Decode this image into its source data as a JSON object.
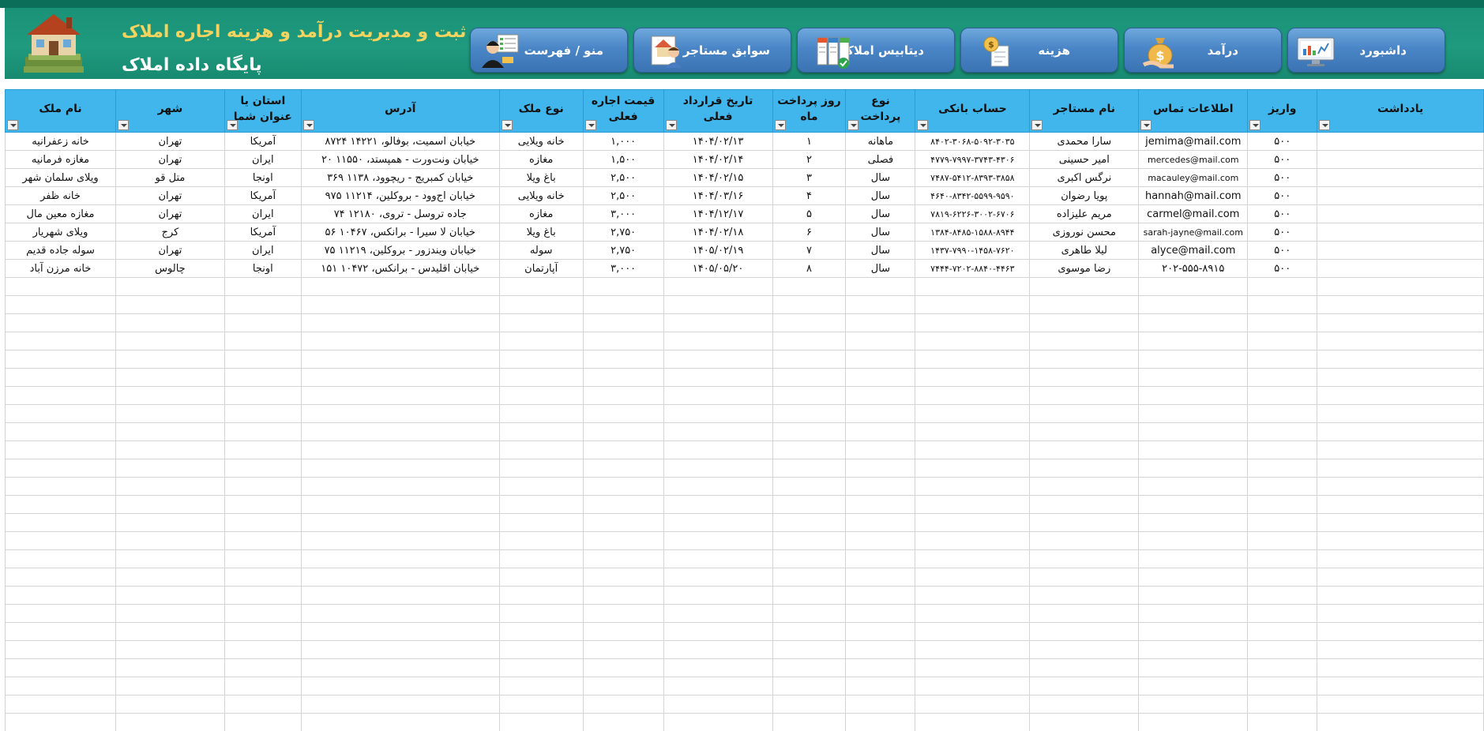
{
  "header": {
    "title": "ثبت و مدیریت درآمد و هزینه اجاره املاک",
    "subtitle": "پایگاه داده املاک"
  },
  "nav": [
    {
      "label": "داشبورد",
      "icon": "dashboard-monitor-icon"
    },
    {
      "label": "درآمد",
      "icon": "money-bag-icon"
    },
    {
      "label": "هزینه",
      "icon": "expense-receipt-icon"
    },
    {
      "label": "دیتابیس املاک",
      "icon": "property-database-icon"
    },
    {
      "label": "سوابق مستاجر",
      "icon": "tenant-history-icon"
    },
    {
      "label": "منو / فهرست",
      "icon": "menu-person-icon"
    }
  ],
  "table": {
    "columns": [
      "یادداشت",
      "واریز",
      "اطلاعات تماس",
      "نام مستاجر",
      "حساب بانکی",
      "نوع پرداخت",
      "روز پرداخت ماه",
      "تاریخ قرارداد فعلی",
      "قیمت اجاره فعلی",
      "نوع ملک",
      "آدرس",
      "استان یا عنوان شما",
      "شهر",
      "نام ملک"
    ],
    "rows": [
      [
        "",
        "۵۰۰",
        "jemima@mail.com",
        "سارا محمدی",
        "۸۴۰۲-۳۰۶۸-۵۰۹۲-۳۰۳۵",
        "ماهانه",
        "۱",
        "۱۴۰۴/۰۲/۱۳",
        "۱,۰۰۰",
        "خانه ویلایی",
        "خیابان اسمیت، بوفالو، ۱۴۲۲۱ ۸۷۲۴",
        "آمریکا",
        "تهران",
        "خانه زعفرانیه"
      ],
      [
        "",
        "۵۰۰",
        "mercedes@mail.com",
        "امیر حسینی",
        "۴۷۷۹-۷۹۹۷-۳۷۴۳-۴۳۰۶",
        "فصلی",
        "۲",
        "۱۴۰۴/۰۲/۱۴",
        "۱,۵۰۰",
        "مغازه",
        "خیابان ونت‌ورت - همپستد، ۱۱۵۵۰ ۲۰",
        "ایران",
        "تهران",
        "مغازه فرمانیه"
      ],
      [
        "",
        "۵۰۰",
        "macauley@mail.com",
        "نرگس اکبری",
        "۷۴۸۷-۵۴۱۲-۸۳۹۳-۳۸۵۸",
        "سال",
        "۳",
        "۱۴۰۴/۰۲/۱۵",
        "۲,۵۰۰",
        "باغ ویلا",
        "خیابان کمبریج - ریچوود، ۱۱۳۸ ۳۶۹",
        "اونجا",
        "متل قو",
        "ویلای سلمان شهر"
      ],
      [
        "",
        "۵۰۰",
        "hannah@mail.com",
        "پویا رضوان",
        "۴۶۴۰-۸۳۴۲-۵۵۹۹-۹۵۹۰",
        "سال",
        "۴",
        "۱۴۰۴/۰۳/۱۶",
        "۲,۵۰۰",
        "خانه ویلایی",
        "خیابان اج‌وود - بروکلین، ۱۱۲۱۴ ۹۷۵",
        "آمریکا",
        "تهران",
        "خانه ظفر"
      ],
      [
        "",
        "۵۰۰",
        "carmel@mail.com",
        "مریم علیزاده",
        "۷۸۱۹-۶۲۲۶-۳۰۰۲-۶۷۰۶",
        "سال",
        "۵",
        "۱۴۰۴/۱۲/۱۷",
        "۳,۰۰۰",
        "مغازه",
        "جاده تروسل - تروی، ۱۲۱۸۰ ۷۴",
        "ایران",
        "تهران",
        "مغازه معین مال"
      ],
      [
        "",
        "۵۰۰",
        "sarah-jayne@mail.com",
        "محسن نوروزی",
        "۱۳۸۴-۸۴۸۵-۱۵۸۸-۸۹۴۴",
        "سال",
        "۶",
        "۱۴۰۴/۰۲/۱۸",
        "۲,۷۵۰",
        "باغ ویلا",
        "خیابان لا سیرا - برانکس، ۱۰۴۶۷ ۵۶",
        "آمریکا",
        "کرج",
        "ویلای شهریار"
      ],
      [
        "",
        "۵۰۰",
        "alyce@mail.com",
        "لیلا طاهری",
        "۱۴۳۷-۷۹۹۰-۱۴۵۸-۷۶۲۰",
        "سال",
        "۷",
        "۱۴۰۵/۰۲/۱۹",
        "۲,۷۵۰",
        "سوله",
        "خیابان ویندزور - بروکلین، ۱۱۲۱۹ ۷۵",
        "ایران",
        "تهران",
        "سوله جاده قدیم"
      ],
      [
        "",
        "۵۰۰",
        "۲۰۲-۵۵۵-۸۹۱۵",
        "رضا موسوی",
        "۷۴۴۴-۷۲۰۲-۸۸۴۰-۴۴۶۳",
        "سال",
        "۸",
        "۱۴۰۵/۰۵/۲۰",
        "۳,۰۰۰",
        "آپارتمان",
        "خیابان اقلیدس - برانکس، ۱۰۴۷۲ ۱۵۱",
        "اونجا",
        "چالوس",
        "خانه مرزن آباد"
      ]
    ]
  }
}
